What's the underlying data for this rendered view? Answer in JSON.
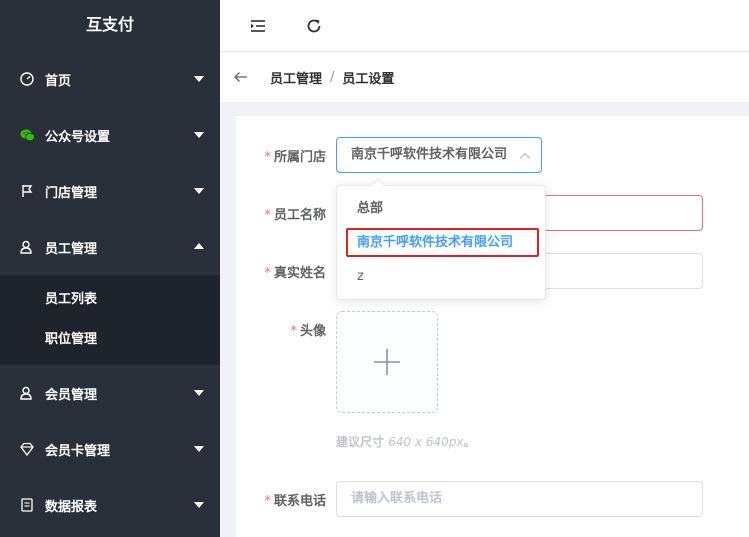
{
  "app": {
    "title": "互支付"
  },
  "sidebar": {
    "items": [
      {
        "label": "首页",
        "icon": "dashboard-icon",
        "expanded": false
      },
      {
        "label": "公众号设置",
        "icon": "wechat-icon",
        "expanded": false
      },
      {
        "label": "门店管理",
        "icon": "flag-icon",
        "expanded": false
      },
      {
        "label": "员工管理",
        "icon": "user-icon",
        "expanded": true
      },
      {
        "label": "会员管理",
        "icon": "user-icon",
        "expanded": false
      },
      {
        "label": "会员卡管理",
        "icon": "diamond-icon",
        "expanded": false
      },
      {
        "label": "数据报表",
        "icon": "report-icon",
        "expanded": false
      }
    ],
    "subitems": [
      {
        "label": "员工列表"
      },
      {
        "label": "职位管理"
      }
    ]
  },
  "header": {
    "fold_icon": "menu-fold-icon",
    "refresh_icon": "refresh-icon"
  },
  "breadcrumb": {
    "items": [
      "员工管理",
      "员工设置"
    ],
    "separator": "/"
  },
  "form": {
    "store": {
      "label": "所属门店",
      "value": "南京千呼软件技术有限公司"
    },
    "name": {
      "label": "员工名称"
    },
    "realname": {
      "label": "真实姓名"
    },
    "avatar": {
      "label": "头像",
      "hint_prefix": "建议尺寸",
      "hint_size": "640 x 640px",
      "hint_suffix": "。"
    },
    "phone": {
      "label": "联系电话",
      "placeholder": "请输入联系电话"
    }
  },
  "dropdown": {
    "options": [
      "总部",
      "南京千呼软件技术有限公司",
      "z"
    ],
    "selected_index": 1
  },
  "colors": {
    "sidebar": "#29303a",
    "submenu": "#1f242c",
    "accent": "#409eff",
    "required": "#f56c6c",
    "highlight": "#e02020"
  }
}
